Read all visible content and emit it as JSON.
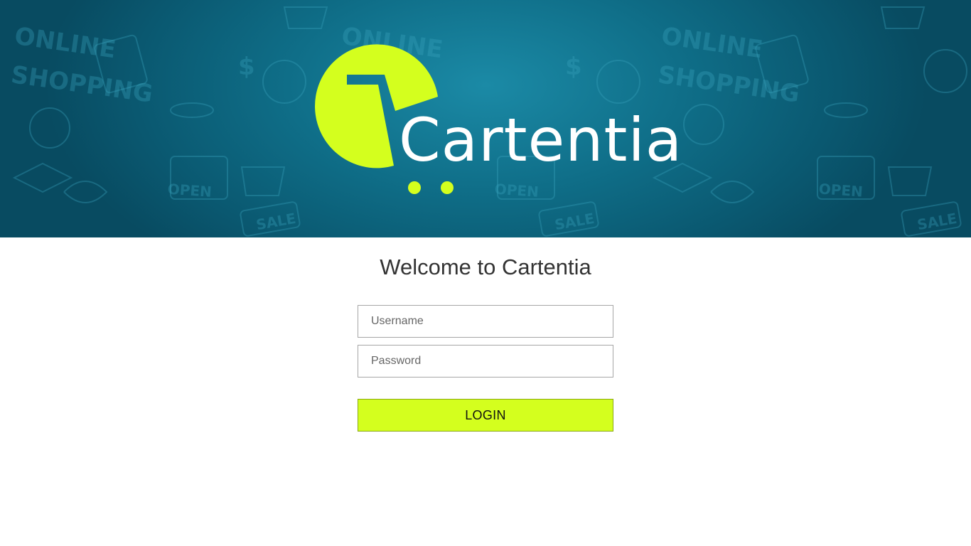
{
  "brand": {
    "name": "Cartentia",
    "accent_color": "#d4ff1e",
    "banner_color": "#0f6e88"
  },
  "banner": {
    "pattern_words": [
      "ONLINE",
      "SHOPPING",
      "OPEN",
      "SALE",
      "$"
    ]
  },
  "welcome": {
    "title": "Welcome to Cartentia"
  },
  "login_form": {
    "username_placeholder": "Username",
    "username_value": "",
    "password_placeholder": "Password",
    "password_value": "",
    "login_label": "LOGIN"
  }
}
